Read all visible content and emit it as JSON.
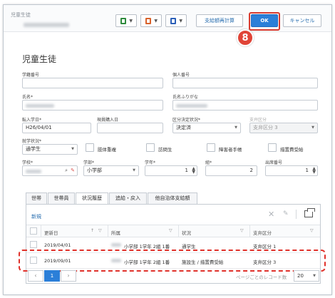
{
  "window": {
    "title": "児童生徒"
  },
  "toolbar": {
    "recalc_label": "支給額再計算",
    "ok_label": "OK",
    "cancel_label": "キャンセル",
    "excel_color": "#2e8b3d",
    "ppt_color": "#d9622b",
    "word_color": "#2b5fb8",
    "step_badge": "8"
  },
  "page": {
    "heading": "児童生徒"
  },
  "form": {
    "shiseki_label": "学籍番号",
    "kojin_label": "個人番号",
    "name_label": "氏名*",
    "kana_label": "氏名ふりがな",
    "tennyu_label": "転入学日*",
    "tennyu_value": "H26/04/01",
    "kenkou_label": "現員購入日",
    "kubun_kettei_label": "区分決定状況*",
    "kubun_kettei_value": "決定済",
    "shikyu_kubun_label": "支弁区分",
    "shikyu_kubun_value": "支弁区分 3",
    "shugaku_label": "就学状況*",
    "shugaku_value": "通学生",
    "chk_hosoku": "肢体重複",
    "chk_houmon": "訪問生",
    "chk_shougai": "障害者手帳",
    "chk_haijo": "措置費受給",
    "gakko_label": "学校*",
    "gakubu_label": "学部*",
    "gakubu_value": "小学部",
    "gakunen_label": "学年*",
    "gakunen_value": "1",
    "kumi_label": "組*",
    "kumi_value": "2",
    "shusseki_label": "出席番号",
    "shusseki_value": "1"
  },
  "tabs": [
    "世帯",
    "世帯員",
    "状況履歴",
    "追給・戻入",
    "他自治体支給額"
  ],
  "grid": {
    "new_label": "新規",
    "columns": [
      "更新日",
      "所属",
      "状況",
      "支弁区分"
    ],
    "rows": [
      {
        "date": "2019/04/01",
        "shozoku": "小学部 1学年 2組 1番",
        "jokyo": "通学生",
        "kubun": "支弁区分 1"
      },
      {
        "date": "2019/09/01",
        "shozoku": "小学部 1学年 2組 1番",
        "jokyo": "施設生 / 措置費受給",
        "kubun": "支弁区分 3"
      }
    ]
  },
  "pager": {
    "prev": "‹",
    "page": "1",
    "next": "›",
    "page_size_label": "ページごとのレコード数",
    "page_size_value": "20"
  }
}
